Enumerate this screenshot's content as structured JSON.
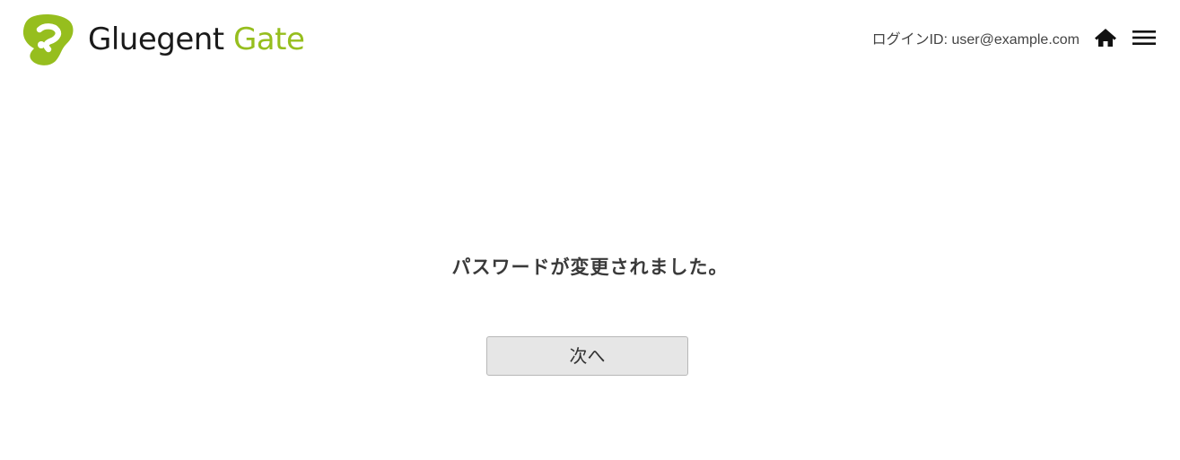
{
  "header": {
    "logo": {
      "word1": "Gluegent",
      "word2": "Gate",
      "icon": "gluegent-logo-mark",
      "brand_color": "#96be1e",
      "text_color": "#1a1a1a"
    },
    "login_id": "ログインID: user@example.com",
    "home_icon": "home-icon",
    "menu_icon": "hamburger-menu-icon"
  },
  "main": {
    "message": "パスワードが変更されました。",
    "next_button_label": "次へ"
  }
}
